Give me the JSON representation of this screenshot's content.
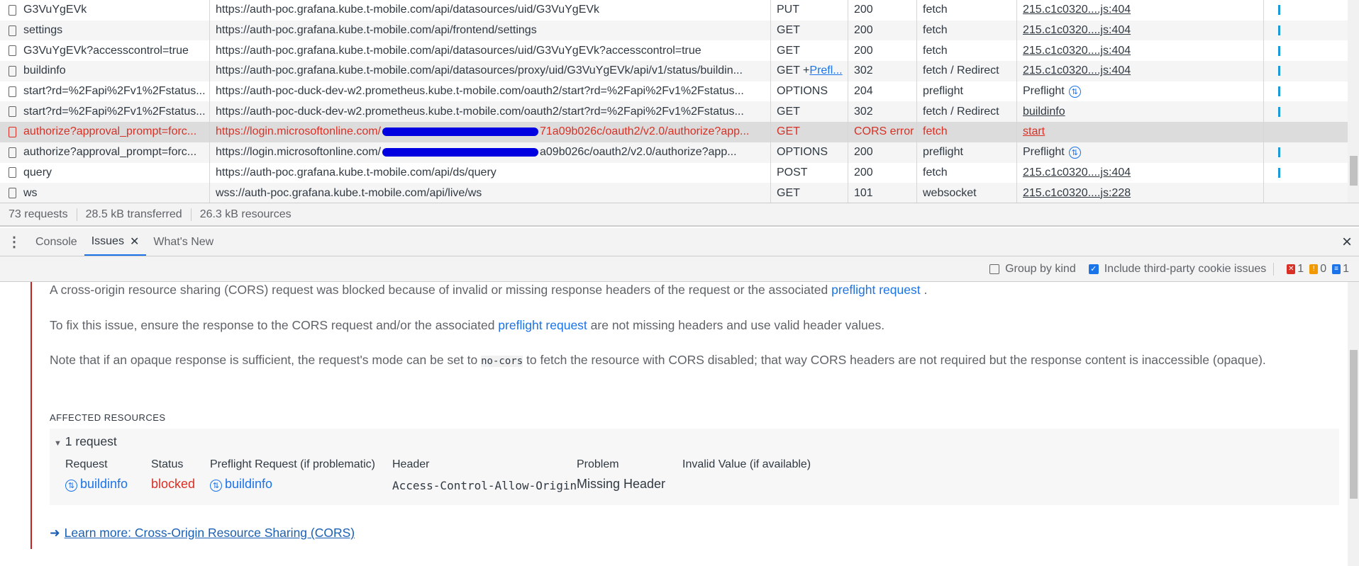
{
  "network": {
    "rows": [
      {
        "name": "G3VuYgEVk",
        "url": "https://auth-poc.grafana.kube.t-mobile.com/api/datasources/uid/G3VuYgEVk",
        "method": "PUT",
        "status": "200",
        "type": "fetch",
        "initiator": "215.c1c0320....js:404"
      },
      {
        "name": "settings",
        "url": "https://auth-poc.grafana.kube.t-mobile.com/api/frontend/settings",
        "method": "GET",
        "status": "200",
        "type": "fetch",
        "initiator": "215.c1c0320....js:404"
      },
      {
        "name": "G3VuYgEVk?accesscontrol=true",
        "url": "https://auth-poc.grafana.kube.t-mobile.com/api/datasources/uid/G3VuYgEVk?accesscontrol=true",
        "method": "GET",
        "status": "200",
        "type": "fetch",
        "initiator": "215.c1c0320....js:404"
      },
      {
        "name": "buildinfo",
        "url": "https://auth-poc.grafana.kube.t-mobile.com/api/datasources/proxy/uid/G3VuYgEVk/api/v1/status/buildin...",
        "method": "GET + ",
        "method_link": "Prefl...",
        "status": "302",
        "type": "fetch / Redirect",
        "initiator": "215.c1c0320....js:404"
      },
      {
        "name": "start?rd=%2Fapi%2Fv1%2Fstatus...",
        "url": "https://auth-poc-duck-dev-w2.prometheus.kube.t-mobile.com/oauth2/start?rd=%2Fapi%2Fv1%2Fstatus...",
        "method": "OPTIONS",
        "status": "204",
        "type": "preflight",
        "initiator": "Preflight"
      },
      {
        "name": "start?rd=%2Fapi%2Fv1%2Fstatus...",
        "url": "https://auth-poc-duck-dev-w2.prometheus.kube.t-mobile.com/oauth2/start?rd=%2Fapi%2Fv1%2Fstatus...",
        "method": "GET",
        "status": "302",
        "type": "fetch / Redirect",
        "initiator": "buildinfo"
      },
      {
        "name": "authorize?approval_prompt=forc...",
        "url": "https://login.microsoftonline.com/",
        "url_tail": "71a09b026c/oauth2/v2.0/authorize?app...",
        "method": "GET",
        "status": "CORS error",
        "type": "fetch",
        "initiator": "start"
      },
      {
        "name": "authorize?approval_prompt=forc...",
        "url": "https://login.microsoftonline.com/",
        "url_tail": "a09b026c/oauth2/v2.0/authorize?app...",
        "method": "OPTIONS",
        "status": "200",
        "type": "preflight",
        "initiator": "Preflight"
      },
      {
        "name": "query",
        "url": "https://auth-poc.grafana.kube.t-mobile.com/api/ds/query",
        "method": "POST",
        "status": "200",
        "type": "fetch",
        "initiator": "215.c1c0320....js:404"
      },
      {
        "name": "ws",
        "url": "wss://auth-poc.grafana.kube.t-mobile.com/api/live/ws",
        "method": "GET",
        "status": "101",
        "type": "websocket",
        "initiator": "215.c1c0320....js:228"
      }
    ]
  },
  "status_bar": {
    "requests": "73 requests",
    "transferred": "28.5 kB transferred",
    "resources": "26.3 kB resources"
  },
  "drawer": {
    "tabs": [
      "Console",
      "Issues",
      "What's New"
    ],
    "close": "×"
  },
  "toolbar": {
    "group_by_kind": "Group by kind",
    "include_third_party": "Include third-party cookie issues",
    "errors": "1",
    "warnings": "0",
    "info": "1"
  },
  "issue": {
    "p1a": "A cross-origin resource sharing (CORS) request was blocked because of invalid or missing response headers of the request or the associated ",
    "p1link": "preflight request",
    "p1b": " .",
    "p2a": "To fix this issue, ensure the response to the CORS request and/or the associated ",
    "p2link": "preflight request",
    "p2b": " are not missing headers and use valid header values.",
    "p3a": "Note that if an opaque response is sufficient, the request's mode can be set to ",
    "p3code": "no-cors",
    "p3b": " to fetch the resource with CORS disabled; that way CORS headers are not required but the response content is inaccessible (opaque).",
    "affected": "AFFECTED RESOURCES",
    "count": "1 request",
    "headers": [
      "Request",
      "Status",
      "Preflight Request (if problematic)",
      "Header",
      "Problem",
      "Invalid Value (if available)"
    ],
    "row": {
      "request": "buildinfo",
      "status": "blocked",
      "preflight": "buildinfo",
      "header": "Access-Control-Allow-Origin",
      "problem": "Missing Header"
    },
    "learn_more": "Learn more: Cross-Origin Resource Sharing (CORS)"
  },
  "colors": {
    "error": "#d93025",
    "link": "#1a73e8",
    "redaction": "#0000e0"
  }
}
